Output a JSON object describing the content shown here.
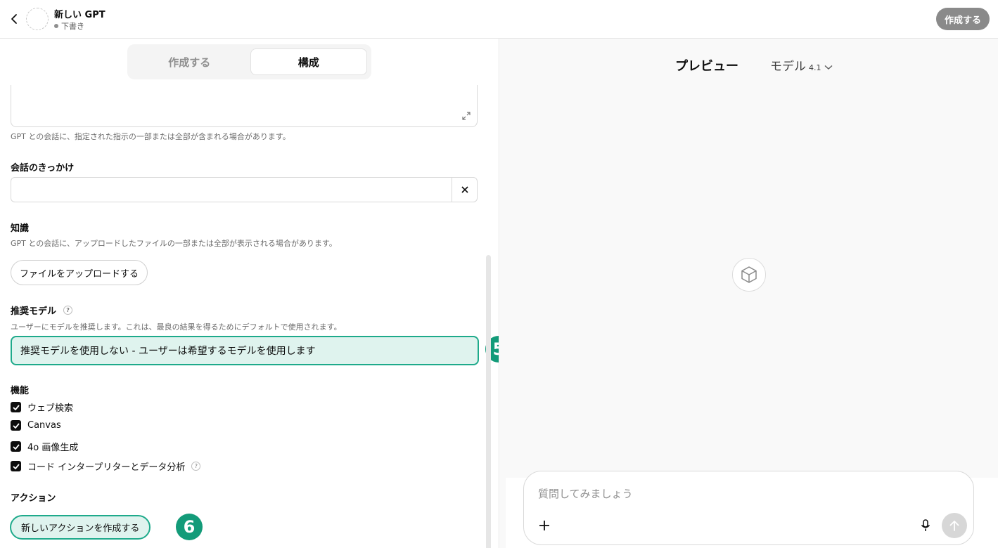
{
  "header": {
    "title": "新しい GPT",
    "status": "下書き",
    "create_button": "作成する"
  },
  "tabs": [
    {
      "label": "作成する",
      "active": false
    },
    {
      "label": "構成",
      "active": true
    }
  ],
  "instructions": {
    "hint": "GPT との会話に、指定された指示の一部または全部が含まれる場合があります。"
  },
  "conversation_starters": {
    "label": "会話のきっかけ",
    "value": ""
  },
  "knowledge": {
    "label": "知識",
    "hint": "GPT との会話に、アップロードしたファイルの一部または全部が表示される場合があります。",
    "upload_button": "ファイルをアップロードする"
  },
  "recommended_model": {
    "label": "推奨モデル",
    "help": "?",
    "hint": "ユーザーにモデルを推奨します。これは、最良の結果を得るためにデフォルトで使用されます。",
    "selected": "推奨モデルを使用しない - ユーザーは希望するモデルを使用します",
    "marker": "5"
  },
  "capabilities": {
    "label": "機能",
    "items": [
      {
        "label": "ウェブ検索",
        "checked": true
      },
      {
        "label": "Canvas",
        "checked": true
      },
      {
        "label": "4o 画像生成",
        "checked": true
      },
      {
        "label": "コード インタープリターとデータ分析",
        "checked": true,
        "help": "?"
      }
    ]
  },
  "actions": {
    "label": "アクション",
    "create_button": "新しいアクションを作成する",
    "marker": "6"
  },
  "preview": {
    "title": "プレビュー",
    "model_label": "モデル",
    "model_version": "4.1",
    "composer_placeholder": "質問してみましょう"
  },
  "colors": {
    "highlight_border": "#1eaa8b",
    "highlight_fill": "#dff3ee",
    "marker": "#139b79"
  }
}
